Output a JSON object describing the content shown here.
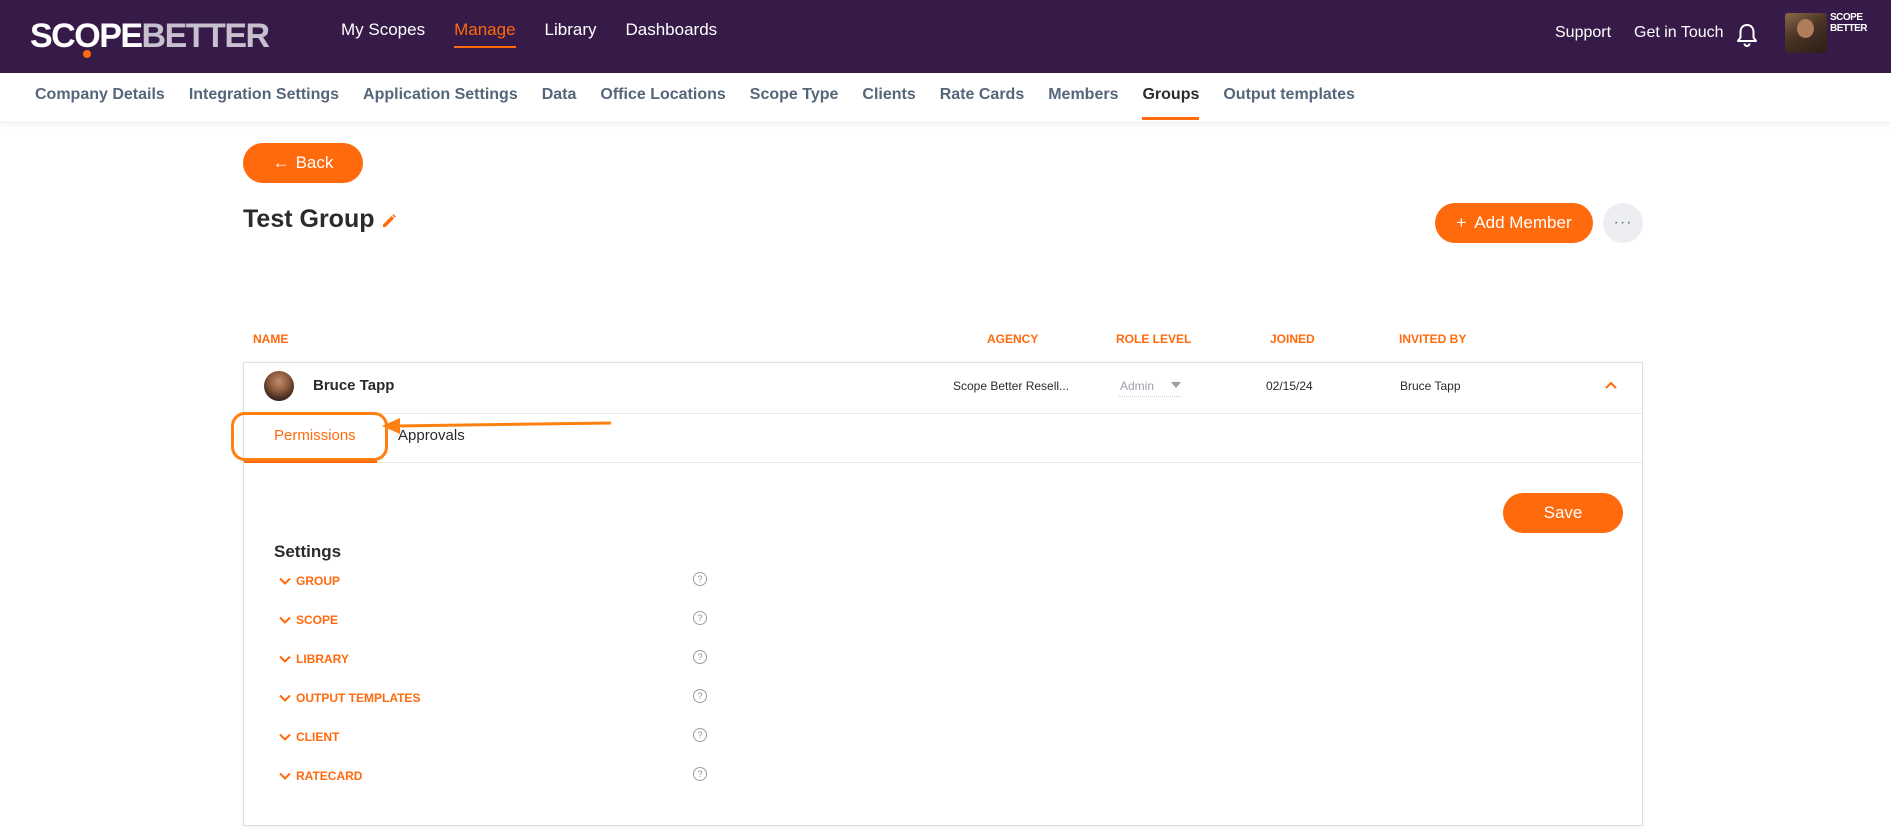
{
  "app": {
    "logo_part1": "SC",
    "logo_o": "O",
    "logo_part2": "PE",
    "logo_part3": "BETTER"
  },
  "main_nav": [
    {
      "label": "My Scopes",
      "active": false
    },
    {
      "label": "Manage",
      "active": true
    },
    {
      "label": "Library",
      "active": false
    },
    {
      "label": "Dashboards",
      "active": false
    }
  ],
  "top_right": {
    "support": "Support",
    "contact": "Get in Touch",
    "company_logo_line1": "SCOPE",
    "company_logo_line2": "BETTER"
  },
  "sub_nav": [
    {
      "label": "Company Details",
      "active": false
    },
    {
      "label": "Integration Settings",
      "active": false
    },
    {
      "label": "Application Settings",
      "active": false
    },
    {
      "label": "Data",
      "active": false
    },
    {
      "label": "Office Locations",
      "active": false
    },
    {
      "label": "Scope Type",
      "active": false
    },
    {
      "label": "Clients",
      "active": false
    },
    {
      "label": "Rate Cards",
      "active": false
    },
    {
      "label": "Members",
      "active": false
    },
    {
      "label": "Groups",
      "active": true
    },
    {
      "label": "Output templates",
      "active": false
    }
  ],
  "page": {
    "back_icon": "←",
    "back_label": "Back",
    "title": "Test Group",
    "add_icon": "+",
    "add_member_label": "Add Member",
    "more_icon": "···"
  },
  "table": {
    "headers": {
      "name": "NAME",
      "agency": "AGENCY",
      "role_level": "ROLE LEVEL",
      "joined": "JOINED",
      "invited_by": "INVITED BY"
    },
    "row": {
      "name": "Bruce Tapp",
      "agency": "Scope Better Resell...",
      "role": "Admin",
      "joined": "02/15/24",
      "invited_by": "Bruce Tapp"
    }
  },
  "tabs": {
    "permissions": "Permissions",
    "approvals": "Approvals"
  },
  "settings": {
    "save_label": "Save",
    "title": "Settings",
    "help_glyph": "?",
    "groups": [
      "GROUP",
      "SCOPE",
      "LIBRARY",
      "OUTPUT TEMPLATES",
      "CLIENT",
      "RATECARD"
    ]
  },
  "colors": {
    "accent": "#ff6a0d",
    "topbar": "#361a47",
    "annotation": "#ff7f11"
  }
}
